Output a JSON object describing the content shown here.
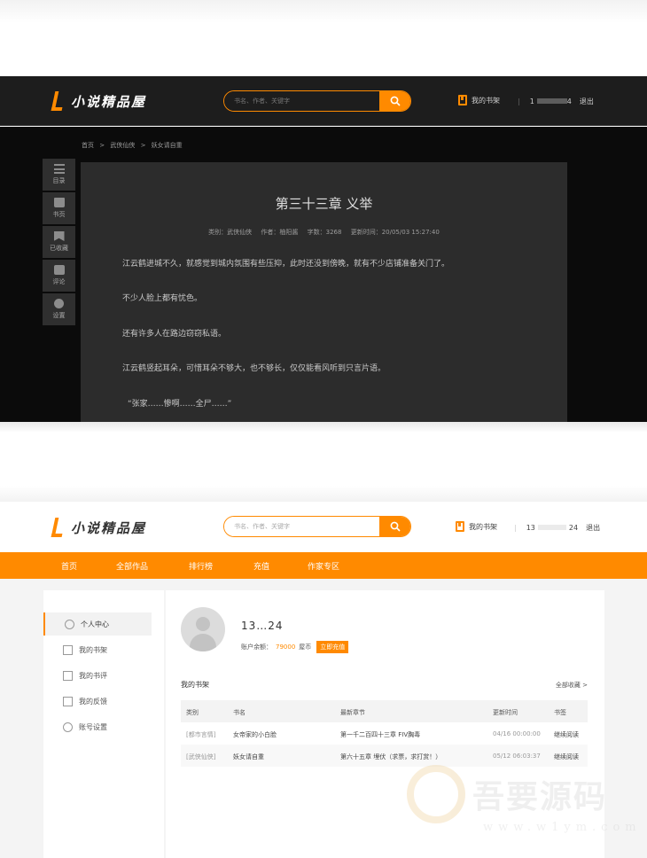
{
  "brand": {
    "name": "小说精品屋",
    "accent": "#ff8a00"
  },
  "reader_page": {
    "search_placeholder": "书名、作者、关键字",
    "shelf_label": "我的书架",
    "user_prefix": "1",
    "user_suffix": "4",
    "logout": "退出",
    "breadcrumb": [
      "首页",
      ">",
      "武侠仙侠",
      ">",
      "妖女请自重"
    ],
    "tools": [
      {
        "label": "目录",
        "icon": "list-icon"
      },
      {
        "label": "书页",
        "icon": "book-icon"
      },
      {
        "label": "已收藏",
        "icon": "bookmark-icon"
      },
      {
        "label": "评论",
        "icon": "comment-icon"
      },
      {
        "label": "设置",
        "icon": "gear-icon"
      }
    ],
    "chapter_title": "第三十三章 义举",
    "meta": {
      "category": "类别：武侠仙侠",
      "author": "作者：柚阳酱",
      "words": "字数：3268",
      "updated": "更新时间：20/05/03 15:27:40"
    },
    "paragraphs": [
      "江云鹤进城不久，就感觉到城内氛围有些压抑，此时还没到傍晚，就有不少店铺准备关门了。",
      "不少人脸上都有忧色。",
      "还有许多人在路边窃窃私语。",
      "江云鹤竖起耳朵，可惜耳朵不够大，也不够长，仅仅能看风听到只言片语。",
      "“张家……惨啊……全尸……”"
    ]
  },
  "user_page": {
    "search_placeholder": "书名、作者、关键字",
    "shelf_label": "我的书架",
    "user_prefix": "13",
    "user_suffix": "24",
    "logout": "退出",
    "nav": [
      "首页",
      "全部作品",
      "排行榜",
      "充值",
      "作家专区"
    ],
    "sidebar": [
      {
        "label": "个人中心",
        "icon": "user-icon"
      },
      {
        "label": "我的书架",
        "icon": "shelf-icon"
      },
      {
        "label": "我的书评",
        "icon": "comment-icon"
      },
      {
        "label": "我的反馈",
        "icon": "mail-icon"
      },
      {
        "label": "账号设置",
        "icon": "gear-icon"
      }
    ],
    "username": "13…24",
    "balance_label": "账户余额：",
    "balance_amount": "79000",
    "balance_unit": "屋币",
    "recharge_label": "立即充值",
    "shelf_title": "我的书架",
    "shelf_all": "全部收藏 >",
    "table": {
      "headers": [
        "类别",
        "书名",
        "最新章节",
        "更新时间",
        "书签"
      ],
      "rows": [
        [
          "[都市言情]",
          "女帝家的小白脸",
          "第一千二百四十三章 FIV胸毒",
          "04/16 00:00:00",
          "继续阅读"
        ],
        [
          "[武侠仙侠]",
          "妖女请自重",
          "第六十五章 埋伏（求票，求打赏！）",
          "05/12 06:03:37",
          "继续阅读"
        ]
      ]
    }
  },
  "watermark": {
    "title": "吾要源码",
    "url": "www.w1ym.com"
  }
}
